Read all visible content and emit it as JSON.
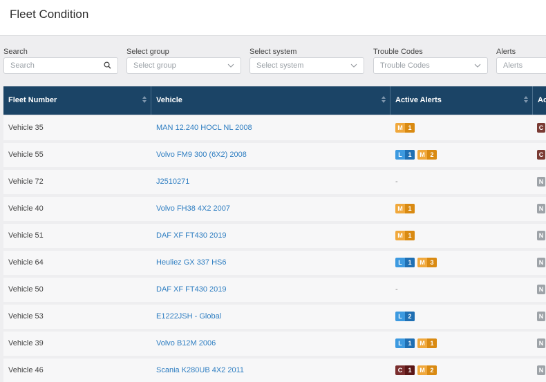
{
  "header": {
    "title": "Fleet Condition"
  },
  "filters": [
    {
      "label": "Search",
      "placeholder": "Search",
      "icon": "search-icon"
    },
    {
      "label": "Select group",
      "placeholder": "Select group",
      "icon": "chevron-down-icon"
    },
    {
      "label": "Select system",
      "placeholder": "Select system",
      "icon": "chevron-down-icon"
    },
    {
      "label": "Trouble Codes",
      "placeholder": "Trouble Codes",
      "icon": "chevron-down-icon"
    },
    {
      "label": "Alerts",
      "placeholder": "Alerts",
      "icon": "chevron-down-icon"
    }
  ],
  "table": {
    "columns": [
      "Fleet Number",
      "Vehicle",
      "Active Alerts",
      "Ac"
    ],
    "rows": [
      {
        "fleet": "Vehicle 35",
        "vehicle": "MAN 12.240 HOCL NL 2008",
        "alerts": [
          {
            "level": "M",
            "count": "1"
          }
        ],
        "extra": "C"
      },
      {
        "fleet": "Vehicle 55",
        "vehicle": "Volvo FM9 300 (6X2) 2008",
        "alerts": [
          {
            "level": "L",
            "count": "1"
          },
          {
            "level": "M",
            "count": "2"
          }
        ],
        "extra": "C"
      },
      {
        "fleet": "Vehicle 72",
        "vehicle": "J2510271",
        "alerts": [],
        "alerts_empty": "-",
        "extra": "N"
      },
      {
        "fleet": "Vehicle 40",
        "vehicle": "Volvo FH38 4X2 2007",
        "alerts": [
          {
            "level": "M",
            "count": "1"
          }
        ],
        "extra": "N"
      },
      {
        "fleet": "Vehicle 51",
        "vehicle": "DAF XF FT430 2019",
        "alerts": [
          {
            "level": "M",
            "count": "1"
          }
        ],
        "extra": "N"
      },
      {
        "fleet": "Vehicle 64",
        "vehicle": "Heuliez GX 337 HS6",
        "alerts": [
          {
            "level": "L",
            "count": "1"
          },
          {
            "level": "M",
            "count": "3"
          }
        ],
        "extra": "N"
      },
      {
        "fleet": "Vehicle 50",
        "vehicle": "DAF XF FT430 2019",
        "alerts": [],
        "alerts_empty": "-",
        "extra": "N"
      },
      {
        "fleet": "Vehicle 53",
        "vehicle": "E1222JSH - Global",
        "alerts": [
          {
            "level": "L",
            "count": "2"
          }
        ],
        "extra": "N"
      },
      {
        "fleet": "Vehicle 39",
        "vehicle": "Volvo B12M 2006",
        "alerts": [
          {
            "level": "L",
            "count": "1"
          },
          {
            "level": "M",
            "count": "1"
          }
        ],
        "extra": "N"
      },
      {
        "fleet": "Vehicle 46",
        "vehicle": "Scania K280UB 4X2 2011",
        "alerts": [
          {
            "level": "C",
            "count": "1"
          },
          {
            "level": "M",
            "count": "2"
          }
        ],
        "extra": "N"
      }
    ]
  },
  "colors": {
    "header_bg": "#1b4466",
    "link": "#2d7dc1",
    "medium": "#f0a83c",
    "low": "#3d9ae0",
    "critical": "#7a2e2e"
  }
}
